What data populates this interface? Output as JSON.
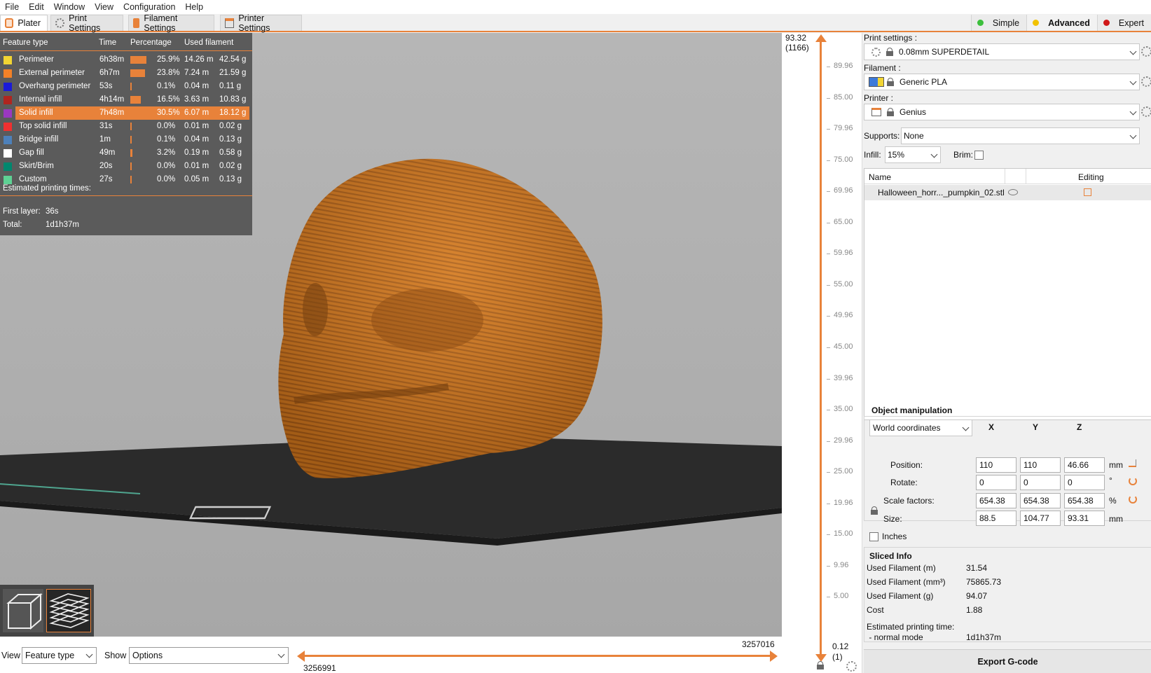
{
  "menu": [
    "File",
    "Edit",
    "Window",
    "View",
    "Configuration",
    "Help"
  ],
  "tabs": [
    {
      "label": "Plater",
      "icon": "plater-icon",
      "active": true
    },
    {
      "label": "Print Settings",
      "icon": "gear-icon"
    },
    {
      "label": "Filament Settings",
      "icon": "filament-spool-icon"
    },
    {
      "label": "Printer Settings",
      "icon": "printer-icon"
    }
  ],
  "modes": [
    {
      "label": "Simple",
      "color": "#3cbf3c"
    },
    {
      "label": "Advanced",
      "color": "#f2c200",
      "active": true
    },
    {
      "label": "Expert",
      "color": "#d01818"
    }
  ],
  "legend": {
    "headers": [
      "Feature type",
      "Time",
      "Percentage",
      "Used filament"
    ],
    "rows": [
      {
        "name": "Perimeter",
        "time": "6h38m",
        "pct": "25.9%",
        "len": "14.26 m",
        "g": "42.54 g",
        "color": "#f2d533",
        "frac": 0.259
      },
      {
        "name": "External perimeter",
        "time": "6h7m",
        "pct": "23.8%",
        "len": "7.24 m",
        "g": "21.59 g",
        "color": "#f28128",
        "frac": 0.238
      },
      {
        "name": "Overhang perimeter",
        "time": "53s",
        "pct": "0.1%",
        "len": "0.04 m",
        "g": "0.11 g",
        "color": "#1a1ad9",
        "frac": 0.001
      },
      {
        "name": "Internal infill",
        "time": "4h14m",
        "pct": "16.5%",
        "len": "3.63 m",
        "g": "10.83 g",
        "color": "#b0251f",
        "frac": 0.165
      },
      {
        "name": "Solid infill",
        "time": "7h48m",
        "pct": "30.5%",
        "len": "6.07 m",
        "g": "18.12 g",
        "color": "#9a38c0",
        "frac": 0.305,
        "selected": true
      },
      {
        "name": "Top solid infill",
        "time": "31s",
        "pct": "0.0%",
        "len": "0.01 m",
        "g": "0.02 g",
        "color": "#f03030",
        "frac": 0.0
      },
      {
        "name": "Bridge infill",
        "time": "1m",
        "pct": "0.1%",
        "len": "0.04 m",
        "g": "0.13 g",
        "color": "#4d80ba",
        "frac": 0.001
      },
      {
        "name": "Gap fill",
        "time": "49m",
        "pct": "3.2%",
        "len": "0.19 m",
        "g": "0.58 g",
        "color": "#ffffff",
        "frac": 0.032
      },
      {
        "name": "Skirt/Brim",
        "time": "20s",
        "pct": "0.0%",
        "len": "0.01 m",
        "g": "0.02 g",
        "color": "#00876e",
        "frac": 0.0
      },
      {
        "name": "Custom",
        "time": "27s",
        "pct": "0.0%",
        "len": "0.05 m",
        "g": "0.13 g",
        "color": "#5ed194",
        "frac": 0.0
      }
    ],
    "est_label": "Estimated printing times:",
    "first_layer_label": "First layer:",
    "first_layer_value": "36s",
    "total_label": "Total:",
    "total_value": "1d1h37m"
  },
  "slider": {
    "top_value": "93.32",
    "top_layer": "(1166)",
    "bottom_value": "0.12",
    "bottom_layer": "(1)",
    "ticks": [
      "89.96",
      "85.00",
      "79.96",
      "75.00",
      "69.96",
      "65.00",
      "59.96",
      "55.00",
      "49.96",
      "45.00",
      "39.96",
      "35.00",
      "29.96",
      "25.00",
      "19.96",
      "15.00",
      "9.96",
      "5.00"
    ]
  },
  "right": {
    "print_settings_label": "Print settings :",
    "print_settings_value": "0.08mm SUPERDETAIL",
    "filament_label": "Filament :",
    "filament_value": "Generic PLA",
    "printer_label": "Printer :",
    "printer_value": "Genius",
    "supports_label": "Supports:",
    "supports_value": "None",
    "infill_label": "Infill:",
    "infill_value": "15%",
    "brim_label": "Brim:",
    "objlist_name_header": "Name",
    "objlist_editing_header": "Editing",
    "object_name": "Halloween_horr..._pumpkin_02.stl",
    "objman_title": "Object manipulation",
    "coord_system": "World coordinates",
    "axes": [
      "X",
      "Y",
      "Z"
    ],
    "position_label": "Position:",
    "position": [
      "110",
      "110",
      "46.66"
    ],
    "position_unit": "mm",
    "rotate_label": "Rotate:",
    "rotate": [
      "0",
      "0",
      "0"
    ],
    "rotate_unit": "°",
    "scale_label": "Scale factors:",
    "scale": [
      "654.38",
      "654.38",
      "654.38"
    ],
    "scale_unit": "%",
    "size_label": "Size:",
    "size": [
      "88.5",
      "104.77",
      "93.31"
    ],
    "size_unit": "mm",
    "inches_label": "Inches",
    "sliced_title": "Sliced Info",
    "sliced_rows": [
      {
        "label": "Used Filament (m)",
        "value": "31.54"
      },
      {
        "label": "Used Filament (mm³)",
        "value": "75865.73"
      },
      {
        "label": "Used Filament (g)",
        "value": "94.07"
      },
      {
        "label": "Cost",
        "value": "1.88"
      }
    ],
    "est_time_label": "Estimated printing time:",
    "normal_mode_label": " - normal mode",
    "normal_mode_value": "1d1h37m",
    "export_label": "Export G-code"
  },
  "bottom": {
    "view_label": "View",
    "view_value": "Feature type",
    "show_label": "Show",
    "show_value": "Options",
    "move_start": "3256991",
    "move_end": "3257016"
  }
}
